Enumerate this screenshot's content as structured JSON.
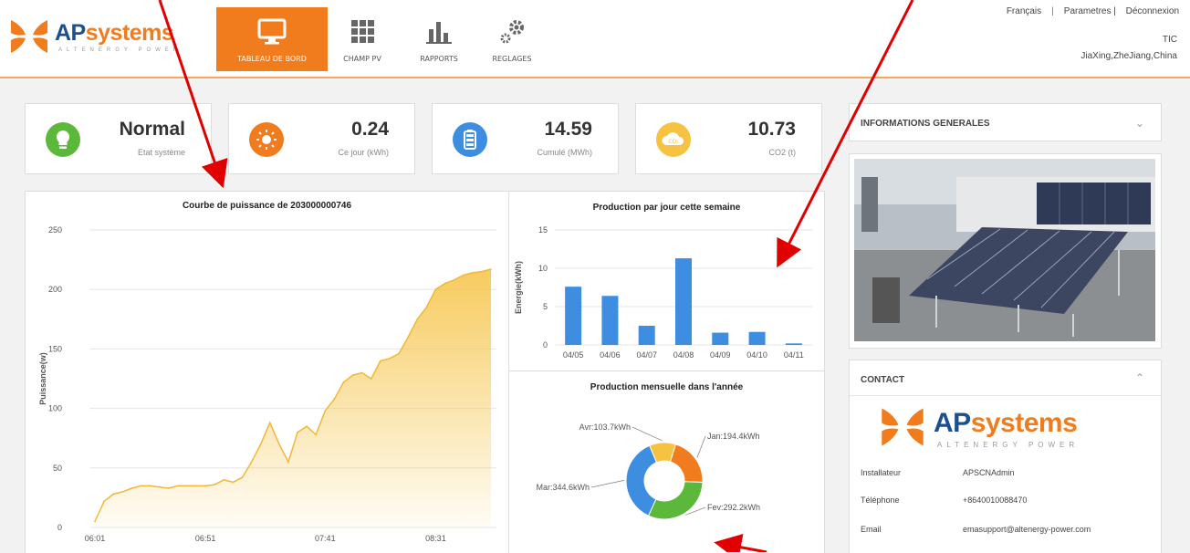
{
  "brand": {
    "name_ap": "AP",
    "name_systems": "systems",
    "tagline": "ALTENERGY POWER"
  },
  "nav": [
    {
      "label": "TABLEAU DE BORD",
      "icon": "monitor-icon",
      "active": true
    },
    {
      "label": "CHAMP PV",
      "icon": "grid-icon",
      "active": false
    },
    {
      "label": "RAPPORTS",
      "icon": "bar-chart-icon",
      "active": false
    },
    {
      "label": "REGLAGES",
      "icon": "gears-icon",
      "active": false
    }
  ],
  "toplinks": {
    "language": "Français",
    "settings": "Parametres |",
    "logout": "Déconnexion"
  },
  "user": {
    "name": "TIC",
    "location": "JiaXing,ZheJiang,China"
  },
  "stats": [
    {
      "value": "Normal",
      "label": "Etat système",
      "icon": "lightbulb-icon",
      "color": "#5cb83a"
    },
    {
      "value": "0.24",
      "label": "Ce jour (kWh)",
      "icon": "sun-icon",
      "color": "#f07c1e"
    },
    {
      "value": "14.59",
      "label": "Cumulé (MWh)",
      "icon": "battery-icon",
      "color": "#3d8ee0"
    },
    {
      "value": "10.73",
      "label": "CO2 (t)",
      "icon": "co2-cloud-icon",
      "color": "#f5c242"
    }
  ],
  "power_curve": {
    "title": "Courbe de puissance de 203000000746",
    "ylabel": "Puissance(w)"
  },
  "weekly": {
    "title": "Production par jour cette semaine",
    "ylabel": "Energie(kWh)"
  },
  "monthly": {
    "title": "Production mensuelle dans l'année"
  },
  "side": {
    "general_title": "INFORMATIONS GENERALES",
    "contact_title": "CONTACT",
    "contact": [
      {
        "label": "Installateur",
        "value": "APSCNAdmin"
      },
      {
        "label": "Téléphone",
        "value": "+8640010088470"
      },
      {
        "label": "Email",
        "value": "emasupport@altenergy-power.com"
      }
    ]
  },
  "chart_data": [
    {
      "type": "area",
      "title": "Courbe de puissance de 203000000746",
      "ylabel": "Puissance(w)",
      "xlabel": "",
      "x_ticks": [
        "06:01",
        "06:51",
        "07:41",
        "08:31"
      ],
      "y_ticks": [
        0,
        50,
        100,
        150,
        200,
        250
      ],
      "ylim": [
        0,
        250
      ],
      "grid": true,
      "color": "#f5c242",
      "x": [
        "06:01",
        "06:05",
        "06:09",
        "06:13",
        "06:17",
        "06:21",
        "06:25",
        "06:29",
        "06:33",
        "06:37",
        "06:41",
        "06:45",
        "06:49",
        "06:53",
        "06:57",
        "07:01",
        "07:05",
        "07:09",
        "07:13",
        "07:17",
        "07:21",
        "07:25",
        "07:29",
        "07:33",
        "07:37",
        "07:41",
        "07:45",
        "07:49",
        "07:53",
        "07:57",
        "08:01",
        "08:05",
        "08:09",
        "08:13",
        "08:17",
        "08:21",
        "08:25",
        "08:29",
        "08:33",
        "08:37",
        "08:41",
        "08:45",
        "08:49",
        "08:53"
      ],
      "values": [
        5,
        22,
        28,
        30,
        33,
        35,
        35,
        34,
        33,
        35,
        35,
        35,
        35,
        36,
        40,
        38,
        42,
        55,
        70,
        88,
        70,
        55,
        80,
        85,
        78,
        98,
        108,
        122,
        128,
        130,
        125,
        140,
        142,
        146,
        160,
        175,
        185,
        200,
        205,
        208,
        212,
        214,
        215,
        217
      ]
    },
    {
      "type": "bar",
      "title": "Production par jour cette semaine",
      "ylabel": "Energie(kWh)",
      "categories": [
        "04/05",
        "04/06",
        "04/07",
        "04/08",
        "04/09",
        "04/10",
        "04/11"
      ],
      "values": [
        7.6,
        6.4,
        2.5,
        11.3,
        1.6,
        1.7,
        0.2
      ],
      "ylim": [
        0,
        15
      ],
      "y_ticks": [
        0,
        5,
        10,
        15
      ],
      "color": "#3d8ee0"
    },
    {
      "type": "pie",
      "title": "Production mensuelle dans l'année",
      "labels": [
        "Jan:194.4kWh",
        "Fev:292.2kWh",
        "Mar:344.6kWh",
        "Avr:103.7kWh"
      ],
      "values": [
        194.4,
        292.2,
        344.6,
        103.7
      ],
      "colors": [
        "#f07c1e",
        "#5cb83a",
        "#3d8ee0",
        "#f5c242"
      ]
    }
  ]
}
